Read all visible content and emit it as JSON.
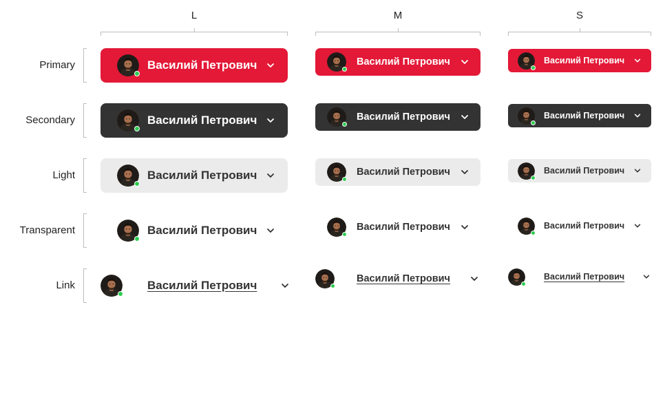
{
  "columns": [
    {
      "id": "L",
      "label": "L"
    },
    {
      "id": "M",
      "label": "M"
    },
    {
      "id": "S",
      "label": "S"
    }
  ],
  "rows": [
    {
      "id": "primary",
      "label": "Primary"
    },
    {
      "id": "secondary",
      "label": "Secondary"
    },
    {
      "id": "light",
      "label": "Light"
    },
    {
      "id": "transparent",
      "label": "Transparent"
    },
    {
      "id": "link",
      "label": "Link"
    }
  ],
  "button": {
    "user_name": "Василий Петрович",
    "avatar_icon": "user-avatar-icon",
    "status_icon": "online-status-icon",
    "dropdown_icon": "chevron-down-icon"
  },
  "colors": {
    "primary": "#e31937",
    "secondary": "#333333",
    "light": "#ebebeb",
    "text_dark": "#333333",
    "online": "#2ecc50"
  }
}
